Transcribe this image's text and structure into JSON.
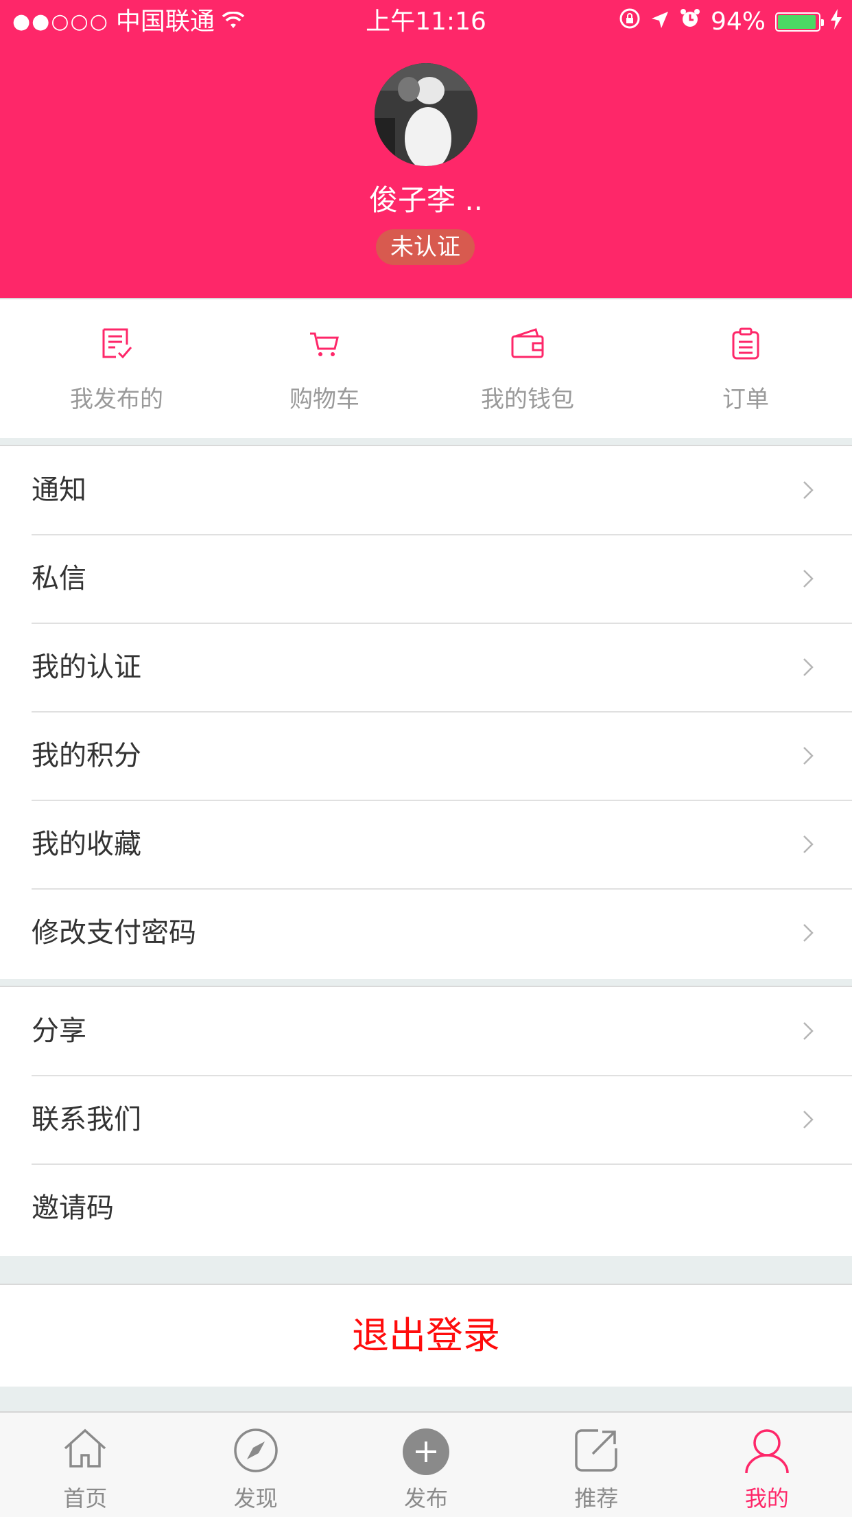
{
  "status_bar": {
    "signal_dots": "●●○○○",
    "carrier": "中国联通",
    "wifi_icon": "wifi-icon",
    "time": "上午11:16",
    "battery_percent": "94%",
    "battery_level": 0.94
  },
  "profile": {
    "username": "俊子李 ..",
    "verification_badge": "未认证"
  },
  "quick_actions": [
    {
      "label": "我发布的",
      "icon": "document-edit-icon"
    },
    {
      "label": "购物车",
      "icon": "cart-icon"
    },
    {
      "label": "我的钱包",
      "icon": "wallet-icon"
    },
    {
      "label": "订单",
      "icon": "clipboard-icon"
    }
  ],
  "menu_group_1": [
    {
      "label": "通知"
    },
    {
      "label": "私信"
    },
    {
      "label": "我的认证"
    },
    {
      "label": "我的积分"
    },
    {
      "label": "我的收藏"
    },
    {
      "label": "修改支付密码"
    }
  ],
  "menu_group_2": [
    {
      "label": "分享"
    },
    {
      "label": "联系我们"
    },
    {
      "label": "邀请码"
    }
  ],
  "logout_label": "退出登录",
  "tabbar": [
    {
      "label": "首页",
      "icon": "home-icon"
    },
    {
      "label": "发现",
      "icon": "compass-icon"
    },
    {
      "label": "发布",
      "icon": "plus-circle-icon"
    },
    {
      "label": "推荐",
      "icon": "share-out-icon"
    },
    {
      "label": "我的",
      "icon": "user-icon",
      "active": true
    }
  ],
  "colors": {
    "accent": "#fe2769",
    "logout": "#ff0c0c",
    "badge": "#d85a4f"
  }
}
